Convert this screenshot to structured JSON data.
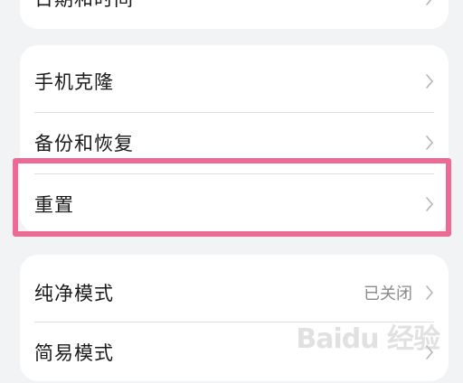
{
  "top_card": {
    "label": "日期和时间"
  },
  "main_card": {
    "items": [
      {
        "label": "手机克隆"
      },
      {
        "label": "备份和恢复"
      },
      {
        "label": "重置"
      }
    ]
  },
  "bottom_card": {
    "items": [
      {
        "label": "纯净模式",
        "value": "已关闭"
      },
      {
        "label": "简易模式"
      }
    ]
  },
  "highlight_color": "#ec6b94",
  "watermark": "Baidu 经验"
}
